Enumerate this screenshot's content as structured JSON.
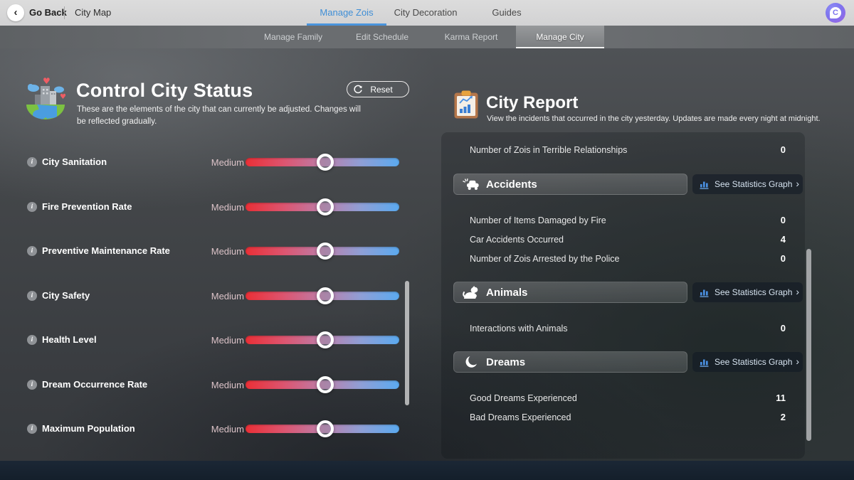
{
  "top_bar": {
    "back_label": "Go Back",
    "map_label": "City Map",
    "tabs": [
      {
        "label": "Manage Zois",
        "active": true
      },
      {
        "label": "City Decoration",
        "active": false
      },
      {
        "label": "Guides",
        "active": false
      }
    ],
    "avatar_letter": "C"
  },
  "sub_bar": {
    "tabs": [
      {
        "label": "Manage Family",
        "active": false
      },
      {
        "label": "Edit Schedule",
        "active": false
      },
      {
        "label": "Karma Report",
        "active": false
      },
      {
        "label": "Manage City",
        "active": true
      }
    ]
  },
  "control_panel": {
    "title": "Control City Status",
    "description": "These are the elements of the city that can currently be adjusted. Changes will be reflected gradually.",
    "reset_label": "Reset",
    "sliders": [
      {
        "label": "City Sanitation",
        "value": "Medium",
        "percent": 52
      },
      {
        "label": "Fire Prevention Rate",
        "value": "Medium",
        "percent": 52
      },
      {
        "label": "Preventive Maintenance Rate",
        "value": "Medium",
        "percent": 52
      },
      {
        "label": "City Safety",
        "value": "Medium",
        "percent": 52
      },
      {
        "label": "Health Level",
        "value": "Medium",
        "percent": 52
      },
      {
        "label": "Dream Occurrence Rate",
        "value": "Medium",
        "percent": 52
      },
      {
        "label": "Maximum Population",
        "value": "Medium",
        "percent": 52
      }
    ]
  },
  "report_panel": {
    "title": "City Report",
    "description": "View the incidents that occurred in the city yesterday. Updates are made every night at midnight.",
    "top_row": {
      "label": "Number of Zois in Terrible Relationships",
      "value": "0"
    },
    "stats_button_label": "See Statistics Graph",
    "sections": [
      {
        "title": "Accidents",
        "icon": "car-crash-icon",
        "rows": [
          {
            "label": "Number of Items Damaged by Fire",
            "value": "0"
          },
          {
            "label": "Car Accidents Occurred",
            "value": "4"
          },
          {
            "label": "Number of Zois Arrested by the Police",
            "value": "0"
          }
        ]
      },
      {
        "title": "Animals",
        "icon": "cat-icon",
        "rows": [
          {
            "label": "Interactions with Animals",
            "value": "0"
          }
        ]
      },
      {
        "title": "Dreams",
        "icon": "moon-icon",
        "rows": [
          {
            "label": "Good Dreams Experienced",
            "value": "11"
          },
          {
            "label": "Bad Dreams Experienced",
            "value": "2"
          }
        ]
      }
    ]
  },
  "colors": {
    "accent_blue": "#3f8ed6",
    "stats_icon_blue": "#4a90e2",
    "slider_red": "#ea2f36",
    "slider_blue": "#5baaf0",
    "medium_value_text": "#dcc3c8",
    "topbar_bg": "#d6d6d7",
    "subbar_bg": "#6a6d70",
    "bottombar_bg": "#172230"
  }
}
